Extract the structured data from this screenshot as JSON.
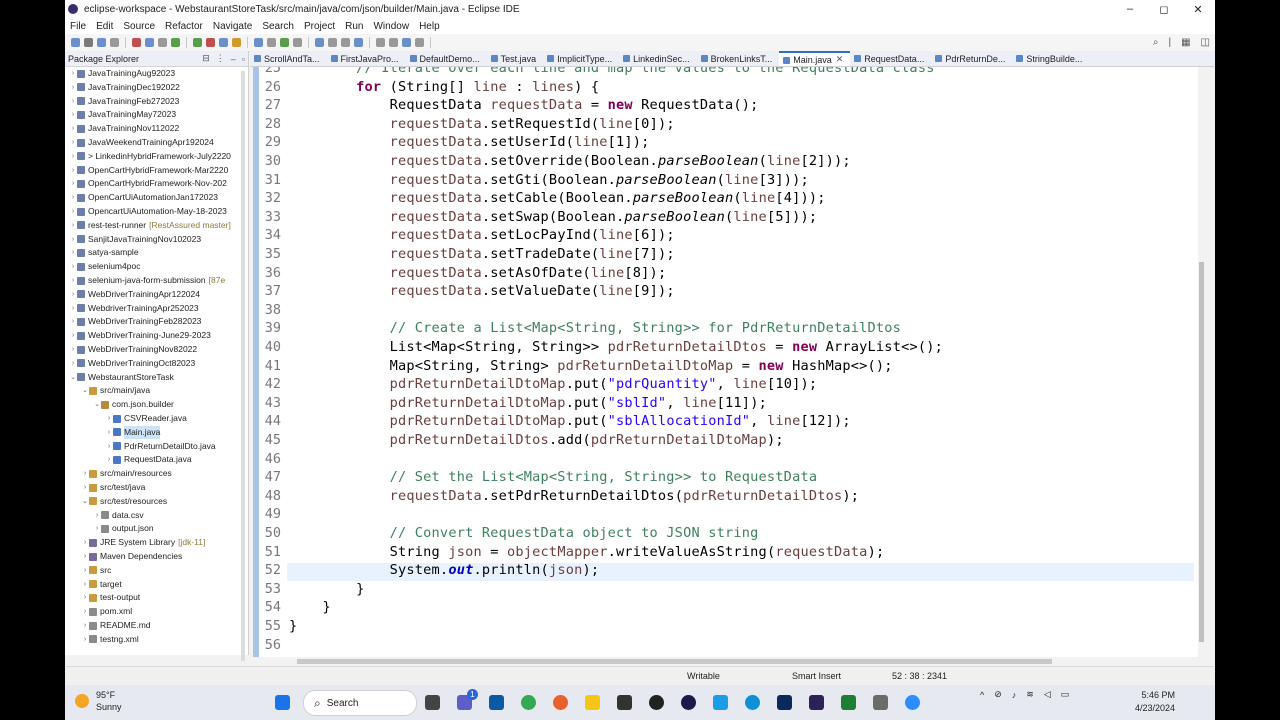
{
  "window": {
    "title": "eclipse-workspace - WebstaurantStoreTask/src/main/java/com/json/builder/Main.java - Eclipse IDE",
    "minimize": "–",
    "maximize": "◻",
    "close": "✕"
  },
  "menu": [
    "File",
    "Edit",
    "Source",
    "Refactor",
    "Navigate",
    "Search",
    "Project",
    "Run",
    "Window",
    "Help"
  ],
  "package_explorer": {
    "title": "Package Explorer",
    "items": [
      {
        "label": "JavaTrainingAug92023",
        "indent": 0,
        "icon": "project"
      },
      {
        "label": "JavaTrainingDec192022",
        "indent": 0,
        "icon": "project"
      },
      {
        "label": "JavaTrainingFeb272023",
        "indent": 0,
        "icon": "project"
      },
      {
        "label": "JavaTrainingMay72023",
        "indent": 0,
        "icon": "project"
      },
      {
        "label": "JavaTrainingNov112022",
        "indent": 0,
        "icon": "project"
      },
      {
        "label": "JavaWeekendTrainingApr192024",
        "indent": 0,
        "icon": "project"
      },
      {
        "label": "> LinkedinHybridFramework-July2220",
        "indent": 0,
        "icon": "project"
      },
      {
        "label": "OpenCartHybridFramework-Mar2220",
        "indent": 0,
        "icon": "project"
      },
      {
        "label": "OpenCartHybridFramework-Nov-202",
        "indent": 0,
        "icon": "project"
      },
      {
        "label": "OpenCartUiAutomationJan172023",
        "indent": 0,
        "icon": "project"
      },
      {
        "label": "OpencartUiAutomation-May-18-2023",
        "indent": 0,
        "icon": "project"
      },
      {
        "label": "rest-test-runner",
        "deco": "[RestAssured master]",
        "indent": 0,
        "icon": "project"
      },
      {
        "label": "SanjitJavaTrainingNov102023",
        "indent": 0,
        "icon": "project"
      },
      {
        "label": "satya-sample",
        "indent": 0,
        "icon": "project"
      },
      {
        "label": "selenium4poc",
        "indent": 0,
        "icon": "project"
      },
      {
        "label": "selenium-java-form-submission",
        "deco": "[87e",
        "indent": 0,
        "icon": "project"
      },
      {
        "label": "WebDriverTrainingApr122024",
        "indent": 0,
        "icon": "project"
      },
      {
        "label": "WebdriverTrainingApr252023",
        "indent": 0,
        "icon": "project"
      },
      {
        "label": "WebDriverTrainingFeb282023",
        "indent": 0,
        "icon": "project"
      },
      {
        "label": "WebDriverTraining-June29-2023",
        "indent": 0,
        "icon": "project"
      },
      {
        "label": "WebDriverTrainingNov82022",
        "indent": 0,
        "icon": "project"
      },
      {
        "label": "WebDriverTrainingOct82023",
        "indent": 0,
        "icon": "project"
      },
      {
        "label": "WebstaurantStoreTask",
        "indent": 0,
        "icon": "project",
        "open": true
      },
      {
        "label": "src/main/java",
        "indent": 1,
        "icon": "folder",
        "open": true
      },
      {
        "label": "com.json.builder",
        "indent": 2,
        "icon": "package",
        "open": true
      },
      {
        "label": "CSVReader.java",
        "indent": 3,
        "icon": "java"
      },
      {
        "label": "Main.java",
        "indent": 3,
        "icon": "java",
        "selected": true
      },
      {
        "label": "PdrReturnDetailDto.java",
        "indent": 3,
        "icon": "java"
      },
      {
        "label": "RequestData.java",
        "indent": 3,
        "icon": "java"
      },
      {
        "label": "src/main/resources",
        "indent": 1,
        "icon": "folder"
      },
      {
        "label": "src/test/java",
        "indent": 1,
        "icon": "folder"
      },
      {
        "label": "src/test/resources",
        "indent": 1,
        "icon": "folder",
        "open": true
      },
      {
        "label": "data.csv",
        "indent": 2,
        "icon": "file"
      },
      {
        "label": "output.json",
        "indent": 2,
        "icon": "file"
      },
      {
        "label": "JRE System Library",
        "deco": "[jdk-11]",
        "indent": 1,
        "icon": "lib"
      },
      {
        "label": "Maven Dependencies",
        "indent": 1,
        "icon": "lib"
      },
      {
        "label": "src",
        "indent": 1,
        "icon": "folder"
      },
      {
        "label": "target",
        "indent": 1,
        "icon": "folder"
      },
      {
        "label": "test-output",
        "indent": 1,
        "icon": "folder"
      },
      {
        "label": "pom.xml",
        "indent": 1,
        "icon": "file"
      },
      {
        "label": "README.md",
        "indent": 1,
        "icon": "file"
      },
      {
        "label": "testng.xml",
        "indent": 1,
        "icon": "file"
      }
    ]
  },
  "editor_tabs": [
    {
      "label": "ScrollAndTa..."
    },
    {
      "label": "FirstJavaPro..."
    },
    {
      "label": "DefaultDemo..."
    },
    {
      "label": "Test.java"
    },
    {
      "label": "ImplicitType..."
    },
    {
      "label": "LinkedinSec..."
    },
    {
      "label": "BrokenLinksT..."
    },
    {
      "label": "Main.java",
      "active": true
    },
    {
      "label": "RequestData..."
    },
    {
      "label": "PdrReturnDe..."
    },
    {
      "label": "StringBuilde..."
    }
  ],
  "code_lines": [
    {
      "n": "25",
      "segs": [
        [
          "        ",
          ""
        ],
        [
          "// Iterate over each line and map the values to the RequestData class",
          "cm"
        ]
      ]
    },
    {
      "n": "26",
      "segs": [
        [
          "        ",
          ""
        ],
        [
          "for",
          "kw"
        ],
        [
          " (String[] ",
          ""
        ],
        [
          "line",
          "vr"
        ],
        [
          " : ",
          ""
        ],
        [
          "lines",
          "vr"
        ],
        [
          ") {",
          ""
        ]
      ]
    },
    {
      "n": "27",
      "segs": [
        [
          "            RequestData ",
          ""
        ],
        [
          "requestData",
          "vr"
        ],
        [
          " = ",
          ""
        ],
        [
          "new",
          "kw"
        ],
        [
          " RequestData();",
          ""
        ]
      ]
    },
    {
      "n": "28",
      "segs": [
        [
          "            ",
          ""
        ],
        [
          "requestData",
          "vr"
        ],
        [
          ".setRequestId(",
          ""
        ],
        [
          "line",
          "vr"
        ],
        [
          "[0]);",
          ""
        ]
      ]
    },
    {
      "n": "29",
      "segs": [
        [
          "            ",
          ""
        ],
        [
          "requestData",
          "vr"
        ],
        [
          ".setUserId(",
          ""
        ],
        [
          "line",
          "vr"
        ],
        [
          "[1]);",
          ""
        ]
      ]
    },
    {
      "n": "30",
      "segs": [
        [
          "            ",
          ""
        ],
        [
          "requestData",
          "vr"
        ],
        [
          ".setOverride(Boolean.",
          ""
        ],
        [
          "parseBoolean",
          "it"
        ],
        [
          "(",
          ""
        ],
        [
          "line",
          "vr"
        ],
        [
          "[2]));",
          ""
        ]
      ]
    },
    {
      "n": "31",
      "segs": [
        [
          "            ",
          ""
        ],
        [
          "requestData",
          "vr"
        ],
        [
          ".setGti(Boolean.",
          ""
        ],
        [
          "parseBoolean",
          "it"
        ],
        [
          "(",
          ""
        ],
        [
          "line",
          "vr"
        ],
        [
          "[3]));",
          ""
        ]
      ]
    },
    {
      "n": "32",
      "segs": [
        [
          "            ",
          ""
        ],
        [
          "requestData",
          "vr"
        ],
        [
          ".setCable(Boolean.",
          ""
        ],
        [
          "parseBoolean",
          "it"
        ],
        [
          "(",
          ""
        ],
        [
          "line",
          "vr"
        ],
        [
          "[4]));",
          ""
        ]
      ]
    },
    {
      "n": "33",
      "segs": [
        [
          "            ",
          ""
        ],
        [
          "requestData",
          "vr"
        ],
        [
          ".setSwap(Boolean.",
          ""
        ],
        [
          "parseBoolean",
          "it"
        ],
        [
          "(",
          ""
        ],
        [
          "line",
          "vr"
        ],
        [
          "[5]));",
          ""
        ]
      ]
    },
    {
      "n": "34",
      "segs": [
        [
          "            ",
          ""
        ],
        [
          "requestData",
          "vr"
        ],
        [
          ".setLocPayInd(",
          ""
        ],
        [
          "line",
          "vr"
        ],
        [
          "[6]);",
          ""
        ]
      ]
    },
    {
      "n": "35",
      "segs": [
        [
          "            ",
          ""
        ],
        [
          "requestData",
          "vr"
        ],
        [
          ".setTradeDate(",
          ""
        ],
        [
          "line",
          "vr"
        ],
        [
          "[7]);",
          ""
        ]
      ]
    },
    {
      "n": "36",
      "segs": [
        [
          "            ",
          ""
        ],
        [
          "requestData",
          "vr"
        ],
        [
          ".setAsOfDate(",
          ""
        ],
        [
          "line",
          "vr"
        ],
        [
          "[8]);",
          ""
        ]
      ]
    },
    {
      "n": "37",
      "segs": [
        [
          "            ",
          ""
        ],
        [
          "requestData",
          "vr"
        ],
        [
          ".setValueDate(",
          ""
        ],
        [
          "line",
          "vr"
        ],
        [
          "[9]);",
          ""
        ]
      ]
    },
    {
      "n": "38",
      "segs": [
        [
          "",
          ""
        ]
      ]
    },
    {
      "n": "39",
      "segs": [
        [
          "            ",
          ""
        ],
        [
          "// Create a List<Map<String, String>> for PdrReturnDetailDtos",
          "cm"
        ]
      ]
    },
    {
      "n": "40",
      "segs": [
        [
          "            List<Map<String, String>> ",
          ""
        ],
        [
          "pdrReturnDetailDtos",
          "vr"
        ],
        [
          " = ",
          ""
        ],
        [
          "new",
          "kw"
        ],
        [
          " ArrayList<>();",
          ""
        ]
      ]
    },
    {
      "n": "41",
      "segs": [
        [
          "            Map<String, String> ",
          ""
        ],
        [
          "pdrReturnDetailDtoMap",
          "vr"
        ],
        [
          " = ",
          ""
        ],
        [
          "new",
          "kw"
        ],
        [
          " HashMap<>();",
          ""
        ]
      ]
    },
    {
      "n": "42",
      "segs": [
        [
          "            ",
          ""
        ],
        [
          "pdrReturnDetailDtoMap",
          "vr"
        ],
        [
          ".put(",
          ""
        ],
        [
          "\"pdrQuantity\"",
          "st"
        ],
        [
          ", ",
          ""
        ],
        [
          "line",
          "vr"
        ],
        [
          "[10]);",
          ""
        ]
      ]
    },
    {
      "n": "43",
      "segs": [
        [
          "            ",
          ""
        ],
        [
          "pdrReturnDetailDtoMap",
          "vr"
        ],
        [
          ".put(",
          ""
        ],
        [
          "\"sblId\"",
          "st"
        ],
        [
          ", ",
          ""
        ],
        [
          "line",
          "vr"
        ],
        [
          "[11]);",
          ""
        ]
      ]
    },
    {
      "n": "44",
      "segs": [
        [
          "            ",
          ""
        ],
        [
          "pdrReturnDetailDtoMap",
          "vr"
        ],
        [
          ".put(",
          ""
        ],
        [
          "\"sblAllocationId\"",
          "st"
        ],
        [
          ", ",
          ""
        ],
        [
          "line",
          "vr"
        ],
        [
          "[12]);",
          ""
        ]
      ]
    },
    {
      "n": "45",
      "segs": [
        [
          "            ",
          ""
        ],
        [
          "pdrReturnDetailDtos",
          "vr"
        ],
        [
          ".add(",
          ""
        ],
        [
          "pdrReturnDetailDtoMap",
          "vr"
        ],
        [
          ");",
          ""
        ]
      ]
    },
    {
      "n": "46",
      "segs": [
        [
          "",
          ""
        ]
      ]
    },
    {
      "n": "47",
      "segs": [
        [
          "            ",
          ""
        ],
        [
          "// Set the List<Map<String, String>> to RequestData",
          "cm"
        ]
      ]
    },
    {
      "n": "48",
      "segs": [
        [
          "            ",
          ""
        ],
        [
          "requestData",
          "vr"
        ],
        [
          ".setPdrReturnDetailDtos(",
          ""
        ],
        [
          "pdrReturnDetailDtos",
          "vr"
        ],
        [
          ");",
          ""
        ]
      ]
    },
    {
      "n": "49",
      "segs": [
        [
          "",
          ""
        ]
      ]
    },
    {
      "n": "50",
      "segs": [
        [
          "            ",
          ""
        ],
        [
          "// Convert RequestData object to JSON string",
          "cm"
        ]
      ]
    },
    {
      "n": "51",
      "segs": [
        [
          "            String ",
          ""
        ],
        [
          "json",
          "vr"
        ],
        [
          " = ",
          ""
        ],
        [
          "objectMapper",
          "vr"
        ],
        [
          ".writeValueAsString(",
          ""
        ],
        [
          "requestData",
          "vr"
        ],
        [
          ");",
          ""
        ]
      ]
    },
    {
      "n": "52",
      "segs": [
        [
          "            System.",
          ""
        ],
        [
          "out",
          "fd"
        ],
        [
          ".println(",
          ""
        ],
        [
          "json",
          "vr"
        ],
        [
          ");",
          ""
        ]
      ]
    },
    {
      "n": "53",
      "segs": [
        [
          "        }",
          ""
        ]
      ]
    },
    {
      "n": "54",
      "segs": [
        [
          "    }",
          ""
        ]
      ]
    },
    {
      "n": "55",
      "segs": [
        [
          "}",
          ""
        ]
      ]
    },
    {
      "n": "56",
      "segs": [
        [
          "",
          ""
        ]
      ]
    }
  ],
  "status": {
    "writable": "Writable",
    "insert": "Smart Insert",
    "position": "52 : 38 : 2341"
  },
  "taskbar": {
    "weather_temp": "95°F",
    "weather_desc": "Sunny",
    "search": "Search",
    "time": "5:46 PM",
    "date": "4/23/2024",
    "badge": "1"
  },
  "colors": {
    "accent": "#2f6fc0",
    "keyword": "#7f0055",
    "comment": "#3f7f5f",
    "string": "#2a00ff"
  }
}
